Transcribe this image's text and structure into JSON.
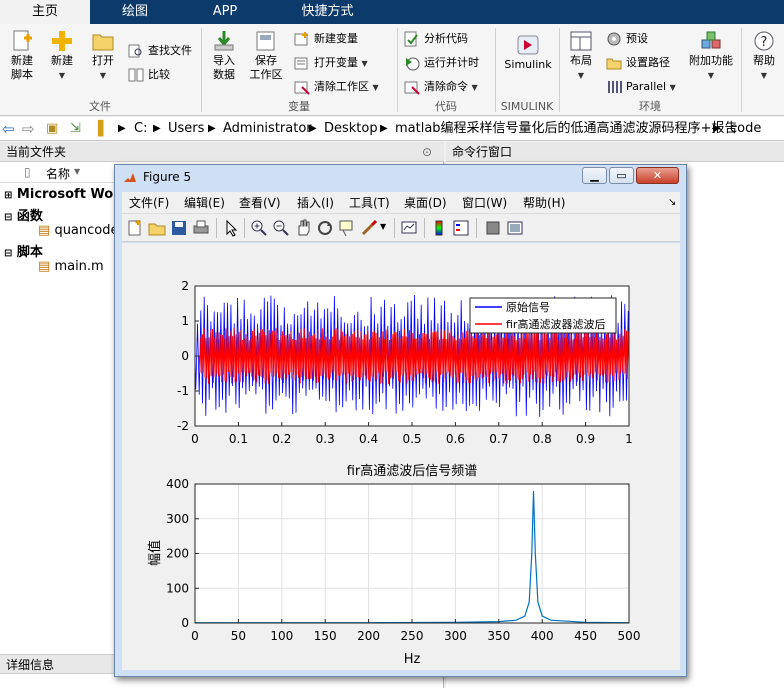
{
  "tabs": [
    "主页",
    "绘图",
    "APP",
    "快捷方式"
  ],
  "ribbon": {
    "new_script": "新建\n脚本",
    "new": "新建",
    "open": "打开",
    "find_files": "查找文件",
    "compare": "比较",
    "import_data": "导入\n数据",
    "save_workspace": "保存\n工作区",
    "new_variable": "新建变量",
    "open_variable": "打开变量",
    "clear_workspace": "清除工作区",
    "analyze_code": "分析代码",
    "run_and_time": "运行并计时",
    "clear_commands": "清除命令",
    "simulink": "Simulink",
    "layout": "布局",
    "preferences": "预设",
    "set_path": "设置路径",
    "parallel": "Parallel",
    "addons": "附加功能",
    "help": "帮助",
    "groups": [
      "文件",
      "变量",
      "代码",
      "SIMULINK",
      "环境"
    ]
  },
  "address": {
    "parts": [
      "C:",
      "Users",
      "Administrator",
      "Desktop",
      "matlab编程采样信号量化后的低通高通滤波源码程序+报告",
      "code"
    ]
  },
  "left_panel": {
    "header": "当前文件夹",
    "column_name": "名称",
    "nodes": [
      "Microsoft Word",
      "函数",
      "quancode",
      "脚本",
      "main.m"
    ],
    "details": "详细信息"
  },
  "right_panel": {
    "header": "命令行窗口"
  },
  "figure": {
    "title": "Figure 5",
    "menu": [
      "文件(F)",
      "编辑(E)",
      "查看(V)",
      "插入(I)",
      "工具(T)",
      "桌面(D)",
      "窗口(W)",
      "帮助(H)"
    ]
  },
  "colors": {
    "tabbar": "#0b3a6b",
    "original_signal": "#0000ff",
    "filtered_signal": "#ff0000",
    "spectrum": "#0072bd"
  },
  "chart_data": [
    {
      "type": "line",
      "title": "",
      "xlabel": "",
      "ylabel": "",
      "xlim": [
        0,
        1
      ],
      "ylim": [
        -2,
        2
      ],
      "xticks": [
        "0",
        "0.1",
        "0.2",
        "0.3",
        "0.4",
        "0.5",
        "0.6",
        "0.7",
        "0.8",
        "0.9",
        "1"
      ],
      "yticks": [
        "-2",
        "-1",
        "0",
        "1",
        "2"
      ],
      "grid": false,
      "legend_position": "top-right",
      "series": [
        {
          "name": "原始信号",
          "color": "#0000ff",
          "x": [
            0,
            0.5,
            1
          ],
          "y": [
            0,
            0,
            0
          ]
        },
        {
          "name": "fir高通滤波器滤波后",
          "color": "#ff0000",
          "x": [
            0,
            0.5,
            1
          ],
          "y": [
            0,
            0,
            0
          ]
        }
      ]
    },
    {
      "type": "line",
      "title": "fir高通滤波后信号频谱",
      "xlabel": "Hz",
      "ylabel": "幅值",
      "xlim": [
        0,
        500
      ],
      "ylim": [
        0,
        400
      ],
      "xticks": [
        "0",
        "50",
        "100",
        "150",
        "200",
        "250",
        "300",
        "350",
        "400",
        "450",
        "500"
      ],
      "yticks": [
        "0",
        "100",
        "200",
        "300",
        "400"
      ],
      "grid": true,
      "series": [
        {
          "name": "",
          "color": "#0072bd",
          "x": [
            0,
            100,
            200,
            300,
            350,
            370,
            380,
            385,
            388,
            390,
            392,
            395,
            400,
            410,
            450,
            500
          ],
          "y": [
            1,
            1,
            1,
            2,
            4,
            8,
            20,
            60,
            200,
            380,
            200,
            60,
            20,
            8,
            2,
            1
          ]
        }
      ]
    }
  ]
}
